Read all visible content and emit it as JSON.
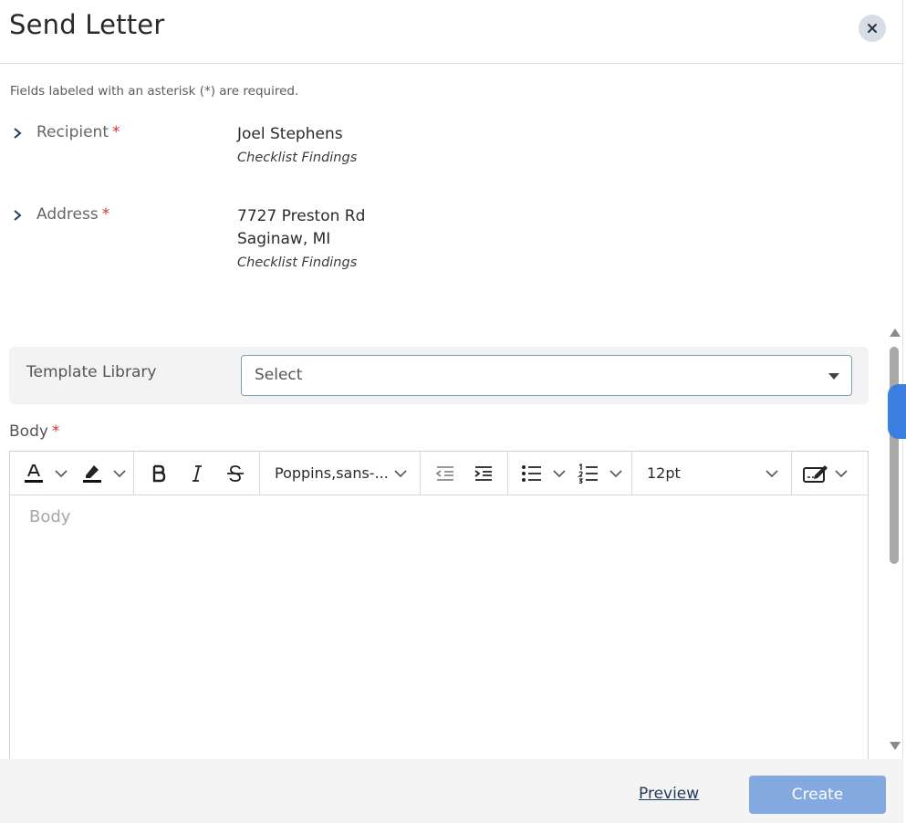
{
  "header": {
    "title": "Send Letter",
    "close_icon": "close-icon"
  },
  "required_note": "Fields labeled with an asterisk (*) are required.",
  "recipient": {
    "label": "Recipient",
    "required_mark": "*",
    "name": "Joel Stephens",
    "source": "Checklist Findings"
  },
  "address": {
    "label": "Address",
    "required_mark": "*",
    "line1": "7727 Preston Rd",
    "line2": "Saginaw, MI",
    "source": "Checklist Findings"
  },
  "template_library": {
    "label": "Template Library",
    "selected": "Select"
  },
  "body": {
    "label": "Body",
    "required_mark": "*",
    "placeholder": "Body"
  },
  "toolbar": {
    "font_family": "Poppins,sans-...",
    "font_size": "12pt",
    "icons": [
      "text-color-icon",
      "highlight-icon",
      "bold-icon",
      "italic-icon",
      "strikethrough-icon",
      "outdent-icon",
      "indent-icon",
      "bullet-list-icon",
      "numbered-list-icon",
      "signature-icon"
    ]
  },
  "footer": {
    "preview_label": "Preview",
    "create_label": "Create"
  },
  "colors": {
    "required_star": "#d0342c",
    "primary_button": "#84a8e0",
    "side_tab": "#3b7fe0"
  }
}
